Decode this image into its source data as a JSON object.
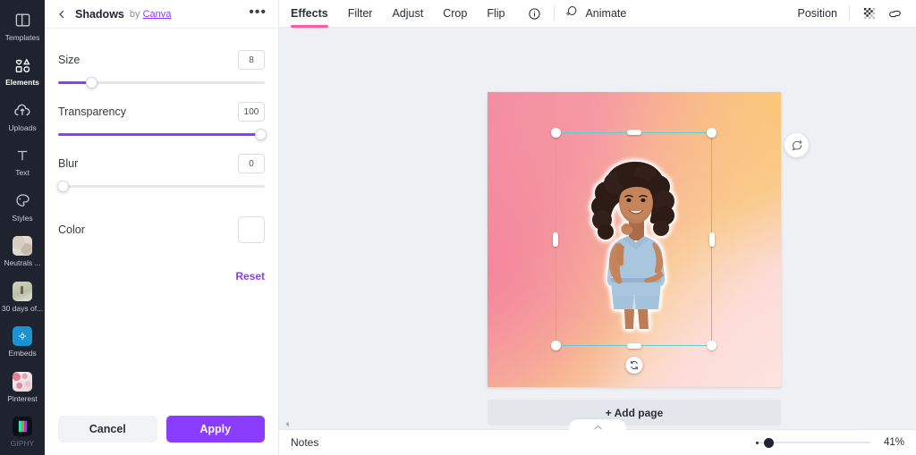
{
  "rail": {
    "items": [
      {
        "label": "Templates",
        "icon": "templates-icon",
        "active": false
      },
      {
        "label": "Elements",
        "icon": "elements-icon",
        "active": true
      },
      {
        "label": "Uploads",
        "icon": "uploads-icon",
        "active": false
      },
      {
        "label": "Text",
        "icon": "text-icon",
        "active": false
      },
      {
        "label": "Styles",
        "icon": "styles-icon",
        "active": false
      },
      {
        "label": "Neutrals ...",
        "icon": "neutrals-thumb",
        "active": false
      },
      {
        "label": "30 days of...",
        "icon": "thirty-days-thumb",
        "active": false
      },
      {
        "label": "Embeds",
        "icon": "embeds-thumb",
        "active": false
      },
      {
        "label": "Pinterest",
        "icon": "pinterest-thumb",
        "active": false
      },
      {
        "label": "GIPHY",
        "icon": "giphy-thumb",
        "active": false
      }
    ]
  },
  "panel": {
    "back_icon": "back-chevron-icon",
    "title": "Shadows",
    "by_prefix": "by",
    "by_link": "Canva",
    "more_icon": "more-options-icon",
    "controls": [
      {
        "label": "Size",
        "value": "8",
        "fill_pct": 16,
        "name": "size"
      },
      {
        "label": "Transparency",
        "value": "100",
        "fill_pct": 100,
        "name": "transparency"
      },
      {
        "label": "Blur",
        "value": "0",
        "fill_pct": 0,
        "name": "blur"
      }
    ],
    "color_label": "Color",
    "color_value": "#ffffff",
    "reset_label": "Reset",
    "cancel_label": "Cancel",
    "apply_label": "Apply",
    "accent": "#8b3dff"
  },
  "topbar": {
    "tabs": [
      {
        "label": "Effects",
        "active": true
      },
      {
        "label": "Filter",
        "active": false
      },
      {
        "label": "Adjust",
        "active": false
      },
      {
        "label": "Crop",
        "active": false
      },
      {
        "label": "Flip",
        "active": false
      }
    ],
    "info_icon": "info-icon",
    "animate_icon": "animate-icon",
    "animate_label": "Animate",
    "position_label": "Position",
    "transparency_icon": "transparency-checkerboard-icon",
    "link_icon": "link-icon",
    "active_underline_color": "#ff5ca0"
  },
  "canvas": {
    "duplicate_icon": "duplicate-page-icon",
    "add_page_icon": "add-page-above-icon",
    "comment_icon": "add-comment-icon",
    "rotate_icon": "rotate-handle-icon",
    "add_page_label": "+ Add page",
    "selection_border_color": "#5ecfd6",
    "gradient_top_left": "#f38fa4",
    "gradient_top_right": "#f9cb93",
    "gradient_bottom_right": "#fbdedb",
    "gradient_bottom_left": "#f4849b"
  },
  "bottombar": {
    "collapse_icon": "collapse-left-icon",
    "pull_icon": "chevron-up-icon",
    "notes_label": "Notes",
    "zoom_value": "41%",
    "zoom_pct": 8
  }
}
